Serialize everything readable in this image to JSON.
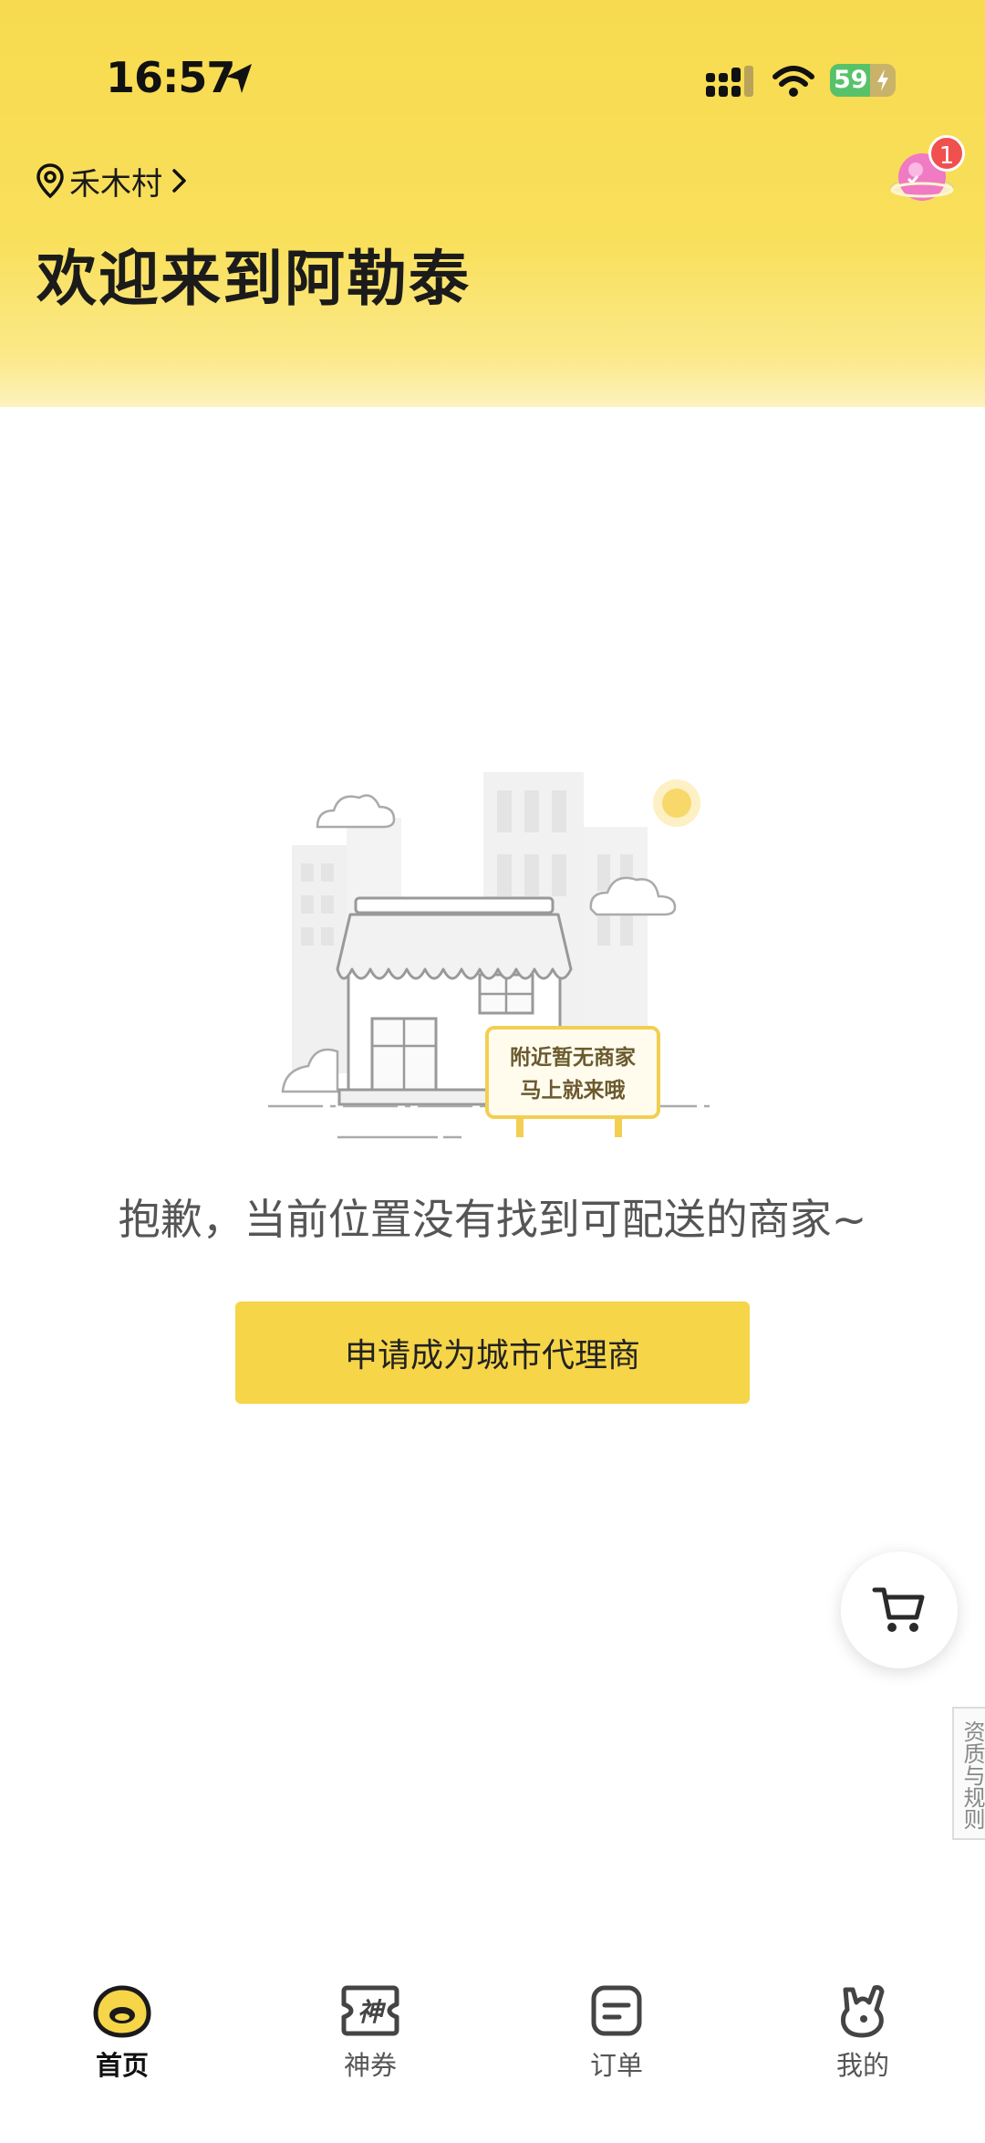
{
  "status_bar": {
    "time": "16:57",
    "battery": "59"
  },
  "header": {
    "location": "禾木村",
    "welcome": "欢迎来到阿勒泰",
    "badge_count": "1"
  },
  "empty_state": {
    "sign_line1": "附近暂无商家",
    "sign_line2": "马上就来哦",
    "message": "抱歉，当前位置没有找到可配送的商家~",
    "button_label": "申请成为城市代理商"
  },
  "side": {
    "rules_label": "资质与规则"
  },
  "tabbar": {
    "tabs": [
      {
        "label": "首页",
        "icon": "home-duck-icon",
        "active": true
      },
      {
        "label": "神券",
        "icon": "coupon-icon",
        "active": false
      },
      {
        "label": "订单",
        "icon": "order-icon",
        "active": false
      },
      {
        "label": "我的",
        "icon": "profile-icon",
        "active": false
      }
    ]
  },
  "colors": {
    "brand_yellow": "#f6d548",
    "badge_red": "#f0504e",
    "battery_green": "#58c26a"
  }
}
